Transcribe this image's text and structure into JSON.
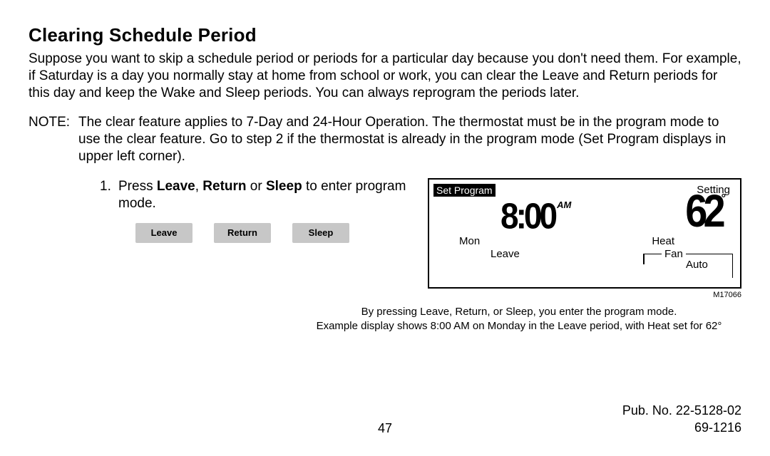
{
  "heading": "Clearing Schedule Period",
  "intro": "Suppose you want to skip a schedule period or periods for a particular day because you don't need them. For example, if Saturday is a day you normally stay at home from school or work, you can clear the Leave and Return periods for this day and keep the Wake and Sleep periods. You can always reprogram the periods later.",
  "note": {
    "label": "NOTE:",
    "body": "The clear feature applies to 7-Day and 24-Hour Operation. The thermostat must be in the program mode to use the clear feature. Go to step 2 if the thermostat is already in the program mode (Set Program displays in upper left corner)."
  },
  "step": {
    "num": "1.",
    "prefix": "Press ",
    "b1": "Leave",
    "sep1": ", ",
    "b2": "Return",
    "sep2": " or ",
    "b3": "Sleep",
    "suffix": " to enter program mode."
  },
  "buttons": {
    "leave": "Leave",
    "return": "Return",
    "sleep": "Sleep"
  },
  "lcd": {
    "badge": "Set Program",
    "setting": "Setting",
    "time": "8:00",
    "ampm": "AM",
    "temp": "62",
    "deg": "°",
    "day": "Mon",
    "period": "Leave",
    "system": "Heat",
    "fan_label": "Fan",
    "fan_mode": "Auto",
    "code": "M17066"
  },
  "caption": {
    "line1": "By pressing Leave, Return, or Sleep, you enter the program mode.",
    "line2": "Example display shows 8:00 AM on Monday in the Leave period, with Heat set for 62°"
  },
  "footer": {
    "page": "47",
    "pub": "Pub. No. 22-5128-02",
    "doc": "69-1216"
  }
}
